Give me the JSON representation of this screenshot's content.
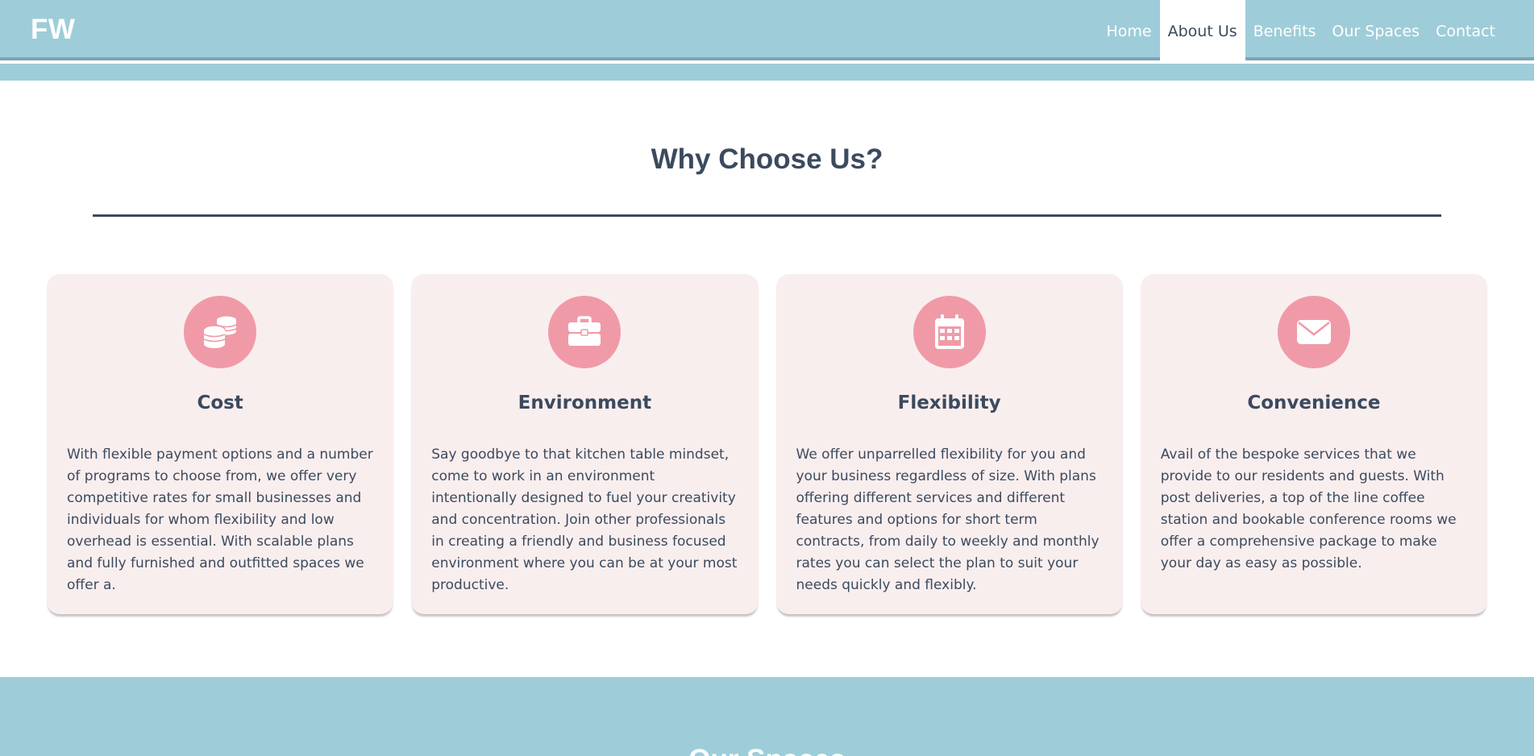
{
  "brand": {
    "logo_text": "FW"
  },
  "nav": {
    "items": [
      {
        "label": "Home",
        "active": false
      },
      {
        "label": "About Us",
        "active": true
      },
      {
        "label": "Benefits",
        "active": false
      },
      {
        "label": "Our Spaces",
        "active": false
      },
      {
        "label": "Contact",
        "active": false
      }
    ]
  },
  "why": {
    "title": "Why Choose Us?",
    "cards": [
      {
        "icon": "coins-icon",
        "title": "Cost",
        "text": "With flexible payment options and a number of programs to choose from, we offer very competitive rates for small businesses and individuals for whom flexibility and low overhead is essential. With scalable plans and fully furnished and outfitted spaces we offer a."
      },
      {
        "icon": "briefcase-icon",
        "title": "Environment",
        "text": "Say goodbye to that kitchen table mindset, come to work in an environment intentionally designed to fuel your creativity and concentration. Join other professionals in creating a friendly and business focused environment where you can be at your most productive."
      },
      {
        "icon": "calendar-icon",
        "title": "Flexibility",
        "text": "We offer unparrelled flexibility for you and your business regardless of size. With plans offering different services and different features and options for short term contracts, from daily to weekly and monthly rates you can select the plan to suit your needs quickly and flexibly."
      },
      {
        "icon": "envelope-icon",
        "title": "Convenience",
        "text": "Avail of the bespoke services that we provide to our residents and guests. With post deliveries, a top of the line coffee station and bookable conference rooms we offer a comprehensive package to make your day as easy as possible."
      }
    ]
  },
  "spaces": {
    "title": "Our Spaces"
  },
  "colors": {
    "header_bg": "#9ecdd9",
    "accent_pink": "#f09aa8",
    "card_bg": "#f9eeee",
    "text_dark": "#3b4a5e"
  }
}
